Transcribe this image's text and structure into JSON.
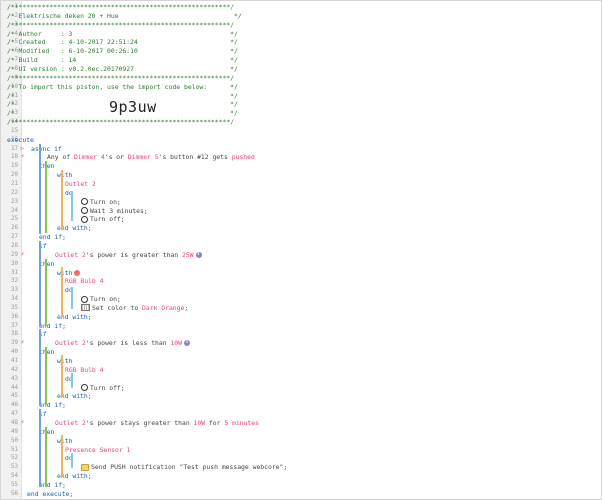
{
  "lines": [
    {
      "n": "1",
      "segs": [
        {
          "t": "/*********************************************************/",
          "c": "com"
        }
      ],
      "ind": 6
    },
    {
      "n": "2",
      "segs": [
        {
          "t": "/* Elektrische deken 20 + Hue                              */",
          "c": "com"
        }
      ],
      "ind": 6
    },
    {
      "n": "3",
      "segs": [
        {
          "t": "/*********************************************************/",
          "c": "com"
        }
      ],
      "ind": 6
    },
    {
      "n": "4",
      "segs": [
        {
          "t": "/* Author     : 3                                         */",
          "c": "com"
        }
      ],
      "ind": 6
    },
    {
      "n": "5",
      "segs": [
        {
          "t": "/* Created    : 4-10-2017 22:51:24                        */",
          "c": "com"
        }
      ],
      "ind": 6
    },
    {
      "n": "6",
      "segs": [
        {
          "t": "/* Modified   : 6-10-2017 00:26:10                        */",
          "c": "com"
        }
      ],
      "ind": 6
    },
    {
      "n": "7",
      "segs": [
        {
          "t": "/* Build      : 14                                        */",
          "c": "com"
        }
      ],
      "ind": 6
    },
    {
      "n": "8",
      "segs": [
        {
          "t": "/* UI version : v0.2.0ec.20170927                         */",
          "c": "com"
        }
      ],
      "ind": 6
    },
    {
      "n": "9",
      "segs": [
        {
          "t": "/*********************************************************/",
          "c": "com"
        }
      ],
      "ind": 6
    },
    {
      "n": "10",
      "segs": [
        {
          "t": "/* To import this piston, use the import code below:      */",
          "c": "com"
        }
      ],
      "ind": 6
    },
    {
      "n": "11",
      "segs": [
        {
          "t": "/*                                                        */",
          "c": "com"
        }
      ],
      "ind": 6
    },
    {
      "n": "12",
      "segs": [
        {
          "t": "/*                                                        */",
          "c": "com"
        }
      ],
      "ind": 6
    },
    {
      "n": "13",
      "segs": [
        {
          "t": "/*                                                        */",
          "c": "com"
        }
      ],
      "ind": 6
    },
    {
      "n": "14",
      "segs": [
        {
          "t": "/*********************************************************/",
          "c": "com"
        }
      ],
      "ind": 6
    },
    {
      "n": "15",
      "segs": [],
      "ind": 6
    },
    {
      "n": "16",
      "segs": [
        {
          "t": "execute",
          "c": "kw"
        }
      ],
      "ind": 6
    },
    {
      "n": "17",
      "segs": [
        {
          "t": "async if",
          "c": "kw"
        }
      ],
      "ind": 30,
      "mark": "purple"
    },
    {
      "n": "18",
      "segs": [
        {
          "t": "Any of ",
          "c": "plain"
        },
        {
          "t": "Dimmer 4",
          "c": "dev"
        },
        {
          "t": "'s or ",
          "c": "plain"
        },
        {
          "t": "Dimmer 5",
          "c": "dev"
        },
        {
          "t": "'s button #12 gets ",
          "c": "plain"
        },
        {
          "t": "pushed",
          "c": "dev"
        }
      ],
      "ind": 46,
      "mark": "red"
    },
    {
      "n": "19",
      "segs": [
        {
          "t": "then",
          "c": "kw"
        }
      ],
      "ind": 38
    },
    {
      "n": "20",
      "segs": [
        {
          "t": "with",
          "c": "kw"
        }
      ],
      "ind": 56
    },
    {
      "n": "21",
      "segs": [
        {
          "t": "Outlet 2",
          "c": "dev"
        }
      ],
      "ind": 64
    },
    {
      "n": "22",
      "segs": [
        {
          "t": "do",
          "c": "kw"
        }
      ],
      "ind": 64
    },
    {
      "n": "23",
      "segs": [
        {
          "t": "Turn on;",
          "c": "plain"
        }
      ],
      "ind": 80,
      "icon": "circle"
    },
    {
      "n": "24",
      "segs": [
        {
          "t": "Wait 3 minutes;",
          "c": "plain"
        }
      ],
      "ind": 80,
      "icon": "circle"
    },
    {
      "n": "25",
      "segs": [
        {
          "t": "Turn off;",
          "c": "plain"
        }
      ],
      "ind": 80,
      "icon": "circle"
    },
    {
      "n": "26",
      "segs": [
        {
          "t": "end with;",
          "c": "kw"
        }
      ],
      "ind": 56
    },
    {
      "n": "27",
      "segs": [
        {
          "t": "end if;",
          "c": "kw"
        }
      ],
      "ind": 38
    },
    {
      "n": "28",
      "segs": [
        {
          "t": "if",
          "c": "kw"
        }
      ],
      "ind": 38
    },
    {
      "n": "29",
      "segs": [
        {
          "t": "Outlet 2",
          "c": "dev"
        },
        {
          "t": "'s power is greater than ",
          "c": "plain"
        },
        {
          "t": "25W",
          "c": "dev"
        }
      ],
      "ind": 54,
      "mark": "red",
      "badge": "i"
    },
    {
      "n": "30",
      "segs": [
        {
          "t": "then",
          "c": "kw"
        }
      ],
      "ind": 38
    },
    {
      "n": "31",
      "segs": [
        {
          "t": "with",
          "c": "kw"
        }
      ],
      "ind": 56,
      "redicon": true
    },
    {
      "n": "32",
      "segs": [
        {
          "t": "RGB Bulb 4",
          "c": "dev"
        }
      ],
      "ind": 64
    },
    {
      "n": "33",
      "segs": [
        {
          "t": "do",
          "c": "kw"
        }
      ],
      "ind": 64
    },
    {
      "n": "34",
      "segs": [
        {
          "t": "Turn on;",
          "c": "plain"
        }
      ],
      "ind": 80,
      "icon": "circle"
    },
    {
      "n": "35",
      "segs": [
        {
          "t": "Set color to ",
          "c": "plain"
        },
        {
          "t": "Dark Orange",
          "c": "dev"
        },
        {
          "t": ";",
          "c": "plain"
        }
      ],
      "ind": 80,
      "icon": "palette"
    },
    {
      "n": "36",
      "segs": [
        {
          "t": "end with;",
          "c": "kw"
        }
      ],
      "ind": 56
    },
    {
      "n": "37",
      "segs": [
        {
          "t": "end if;",
          "c": "kw"
        }
      ],
      "ind": 38
    },
    {
      "n": "38",
      "segs": [
        {
          "t": "if",
          "c": "kw"
        }
      ],
      "ind": 38
    },
    {
      "n": "39",
      "segs": [
        {
          "t": "Outlet 2",
          "c": "dev"
        },
        {
          "t": "'s power is less than ",
          "c": "plain"
        },
        {
          "t": "10W",
          "c": "dev"
        }
      ],
      "ind": 54,
      "mark": "red",
      "badge": "i"
    },
    {
      "n": "40",
      "segs": [
        {
          "t": "then",
          "c": "kw"
        }
      ],
      "ind": 38
    },
    {
      "n": "41",
      "segs": [
        {
          "t": "with",
          "c": "kw"
        }
      ],
      "ind": 56
    },
    {
      "n": "42",
      "segs": [
        {
          "t": "RGB Bulb 4",
          "c": "dev"
        }
      ],
      "ind": 64
    },
    {
      "n": "43",
      "segs": [
        {
          "t": "do",
          "c": "kw"
        }
      ],
      "ind": 64
    },
    {
      "n": "44",
      "segs": [
        {
          "t": "Turn off;",
          "c": "plain"
        }
      ],
      "ind": 80,
      "icon": "circle"
    },
    {
      "n": "45",
      "segs": [
        {
          "t": "end with;",
          "c": "kw"
        }
      ],
      "ind": 56
    },
    {
      "n": "46",
      "segs": [
        {
          "t": "end if;",
          "c": "kw"
        }
      ],
      "ind": 38
    },
    {
      "n": "47",
      "segs": [
        {
          "t": "if",
          "c": "kw"
        }
      ],
      "ind": 38
    },
    {
      "n": "48",
      "segs": [
        {
          "t": "Outlet 2",
          "c": "dev"
        },
        {
          "t": "'s power stays greater than ",
          "c": "plain"
        },
        {
          "t": "10W",
          "c": "dev"
        },
        {
          "t": " for ",
          "c": "plain"
        },
        {
          "t": "5 minutes",
          "c": "dev"
        }
      ],
      "ind": 54,
      "mark": "red"
    },
    {
      "n": "49",
      "segs": [
        {
          "t": "then",
          "c": "kw"
        }
      ],
      "ind": 38
    },
    {
      "n": "50",
      "segs": [
        {
          "t": "with",
          "c": "kw"
        }
      ],
      "ind": 56
    },
    {
      "n": "51",
      "segs": [
        {
          "t": "Presence Sensor 1",
          "c": "dev"
        }
      ],
      "ind": 64
    },
    {
      "n": "52",
      "segs": [
        {
          "t": "do",
          "c": "kw"
        }
      ],
      "ind": 64
    },
    {
      "n": "53",
      "segs": [
        {
          "t": "Send PUSH notification \"Test push message webcore\";",
          "c": "plain"
        }
      ],
      "ind": 80,
      "icon": "msg"
    },
    {
      "n": "54",
      "segs": [
        {
          "t": "end with;",
          "c": "kw"
        }
      ],
      "ind": 56
    },
    {
      "n": "55",
      "segs": [
        {
          "t": "end if;",
          "c": "kw"
        }
      ],
      "ind": 38
    },
    {
      "n": "56",
      "segs": [
        {
          "t": "end execute;",
          "c": "kw"
        }
      ],
      "ind": 26
    }
  ],
  "import_code": "9p3uw",
  "colors": {
    "comment": "#2e7d32",
    "keyword": "#1a5fb4",
    "device": "#e6467a",
    "plain": "#444444",
    "marker_red": "#e8403a",
    "marker_purple": "#9b59b6"
  }
}
